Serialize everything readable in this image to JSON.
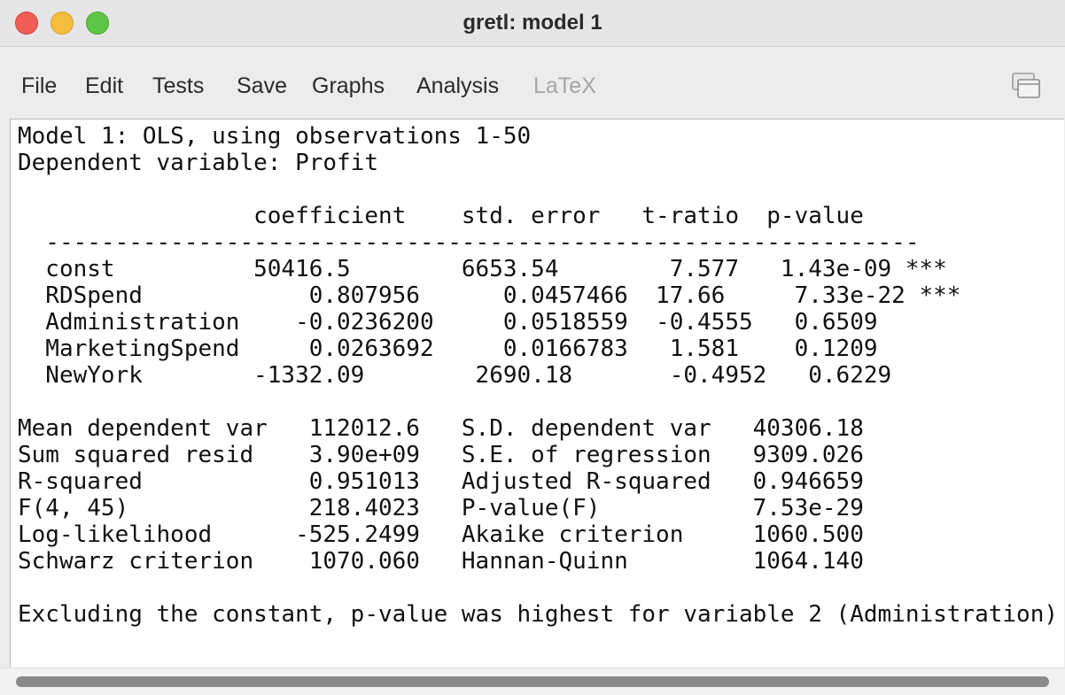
{
  "window": {
    "title": "gretl: model 1"
  },
  "menu": {
    "items": [
      {
        "label": "File",
        "enabled": true
      },
      {
        "label": "Edit",
        "enabled": true
      },
      {
        "label": "Tests",
        "enabled": true
      },
      {
        "label": "Save",
        "enabled": true
      },
      {
        "label": "Graphs",
        "enabled": true
      },
      {
        "label": "Analysis",
        "enabled": true
      },
      {
        "label": "LaTeX",
        "enabled": false
      }
    ],
    "window_button_icon": "window-stack-icon"
  },
  "output": {
    "lines": [
      "Model 1: OLS, using observations 1-50",
      "Dependent variable: Profit",
      "",
      "                 coefficient    std. error   t-ratio  p-value",
      "  ---------------------------------------------------------------",
      "  const          50416.5        6653.54        7.577   1.43e-09 ***",
      "  RDSpend            0.807956      0.0457466  17.66     7.33e-22 ***",
      "  Administration    -0.0236200     0.0518559  -0.4555   0.6509",
      "  MarketingSpend     0.0263692     0.0166783   1.581    0.1209",
      "  NewYork        -1332.09        2690.18       -0.4952   0.6229",
      "",
      "Mean dependent var   112012.6   S.D. dependent var   40306.18",
      "Sum squared resid    3.90e+09   S.E. of regression   9309.026",
      "R-squared            0.951013   Adjusted R-squared   0.946659",
      "F(4, 45)             218.4023   P-value(F)           7.53e-29",
      "Log-likelihood      -525.2499   Akaike criterion     1060.500",
      "Schwarz criterion    1070.060   Hannan-Quinn         1064.140",
      "",
      "Excluding the constant, p-value was highest for variable 2 (Administration)"
    ]
  }
}
